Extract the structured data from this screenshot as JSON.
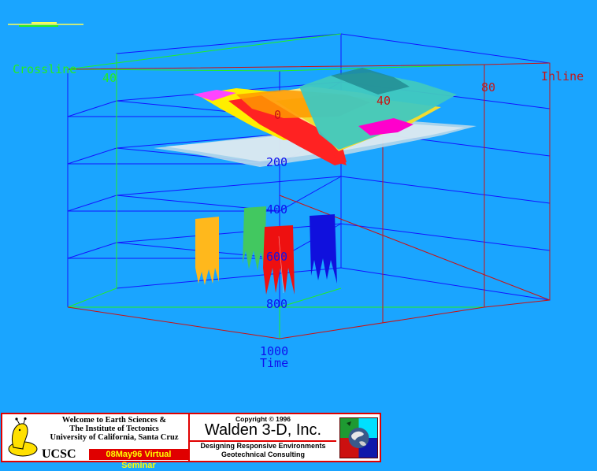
{
  "scene": {
    "inline_axis_label": "Inline",
    "crossline_axis_label": "Crossline",
    "time_axis_label": "Time",
    "inline_ticks": [
      "0",
      "40",
      "80"
    ],
    "crossline_ticks": [
      "40"
    ],
    "time_ticks": [
      "200",
      "400",
      "600",
      "800",
      "1000"
    ]
  },
  "colors": {
    "background": "#1aa5ff",
    "box_blue": "#1414ff",
    "box_green": "#22ee22",
    "box_red": "#cc1111",
    "label_red": "#c81414",
    "label_blue": "#1010ee",
    "label_green": "#22ee22"
  },
  "banner": {
    "welcome_lines": [
      "Welcome to Earth Sciences &",
      "The Institute of Tectonics",
      "University of California, Santa Cruz"
    ],
    "ucsc": "UCSC",
    "seminar": "08May96 Virtual Seminar",
    "copyright": "Copyright © 1996",
    "company": "Walden 3-D, Inc.",
    "tagline_1": "Designing Responsive Environments",
    "tagline_2": "Geotechnical Consulting"
  }
}
